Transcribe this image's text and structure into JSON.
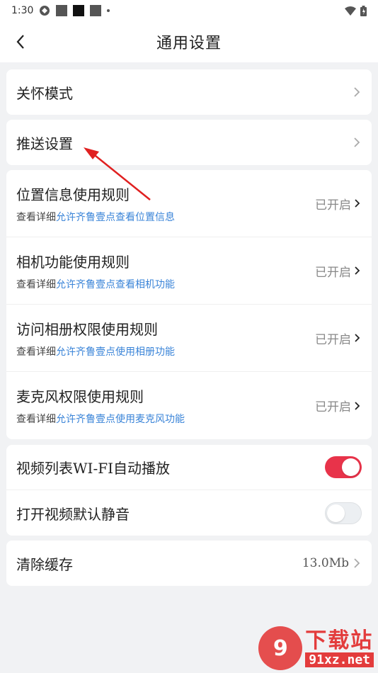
{
  "status_bar": {
    "time": "1:30"
  },
  "header": {
    "title": "通用设置"
  },
  "card_care": {
    "label": "关怀模式"
  },
  "card_push": {
    "label": "推送设置"
  },
  "rules": [
    {
      "title": "位置信息使用规则",
      "sub_prefix": "查看详细",
      "sub_link": "允许齐鲁壹点查看位置信息",
      "status": "已开启"
    },
    {
      "title": "相机功能使用规则",
      "sub_prefix": "查看详细",
      "sub_link": "允许齐鲁壹点查看相机功能",
      "status": "已开启"
    },
    {
      "title": "访问相册权限使用规则",
      "sub_prefix": "查看详细",
      "sub_link": "允许齐鲁壹点使用相册功能",
      "status": "已开启"
    },
    {
      "title": "麦克风权限使用规则",
      "sub_prefix": "查看详细",
      "sub_link": "允许齐鲁壹点使用麦克风功能",
      "status": "已开启"
    }
  ],
  "toggles": [
    {
      "label": "视频列表WI-FI自动播放",
      "on": true
    },
    {
      "label": "打开视频默认静音",
      "on": false
    }
  ],
  "cache": {
    "label": "清除缓存",
    "value": "13.0Mb"
  },
  "watermark": {
    "main": "下载站",
    "sub": "91xz.net",
    "logo": "9"
  },
  "colors": {
    "accent": "#e8334a",
    "link": "#3a84d8",
    "background": "#f1f2f4"
  }
}
